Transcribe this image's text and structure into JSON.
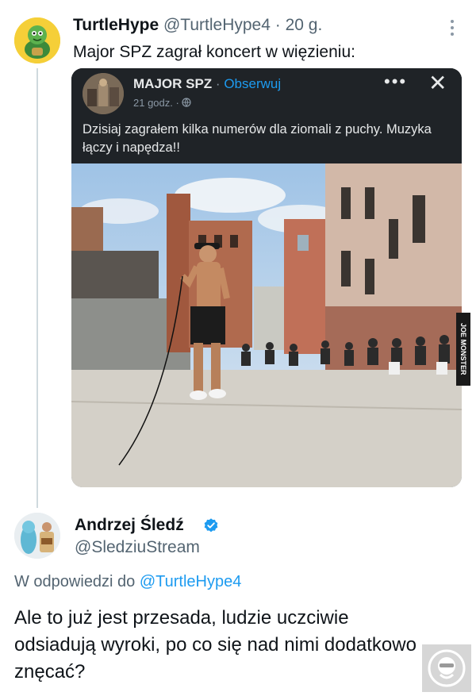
{
  "tweet": {
    "author_name": "TurtleHype",
    "author_handle": "@TurtleHype4",
    "separator": "·",
    "date": "20 g.",
    "text": "Major SPZ zagrał koncert w więzieniu:",
    "menu_icon": "more-vertical-icon"
  },
  "embedded_post": {
    "author_name": "MAJOR SPZ",
    "separator": "·",
    "follow_label": "Obserwuj",
    "time": "21 godz.",
    "time_separator": "·",
    "visibility_icon": "globe-icon",
    "more_icon": "more-horizontal-icon",
    "more_label": "•••",
    "close_icon": "close-icon",
    "close_label": "✕",
    "text": "Dzisiaj zagrałem kilka numerów dla ziomali z puchy. Muzyka łączy i napędza!!",
    "image_icon": "photo-concert-prison-yard"
  },
  "watermark_side": "JOE MONSTER",
  "reply": {
    "author_name": "Andrzej Śledź",
    "verified_icon": "verified-badge-icon",
    "author_handle": "@SledziuStream",
    "reply_prefix": "W odpowiedzi do",
    "reply_mention": "@TurtleHype4",
    "text": "Ale to już jest przesada, ludzie uczciwie odsiadują wyroki, po co się nad nimi dodatkowo znęcać?"
  },
  "colors": {
    "link": "#1d9bf0",
    "secondary_text": "#536471",
    "embed_background": "#1f2327",
    "thread_line": "#cfd9de"
  }
}
